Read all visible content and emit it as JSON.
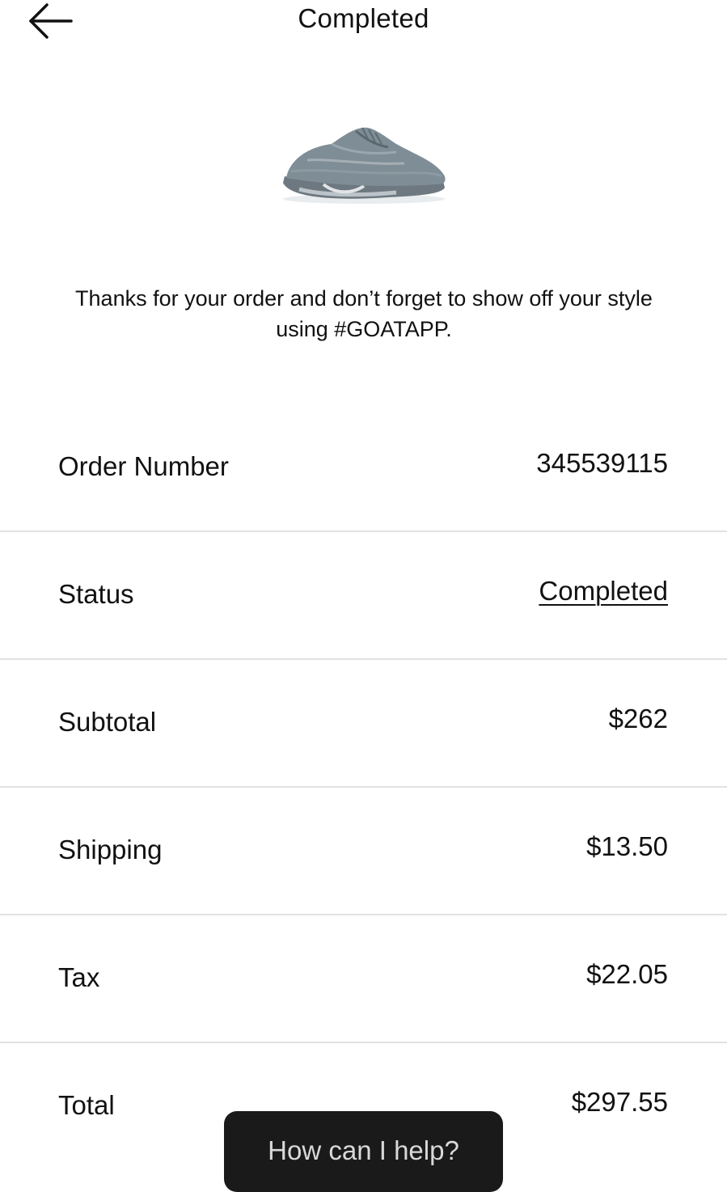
{
  "header": {
    "back_icon": "arrow-left-icon",
    "title": "Completed"
  },
  "product": {
    "image_icon": "sneaker-image"
  },
  "message": "Thanks for your order and don’t forget to show off your style using #GOATAPP.",
  "details": [
    {
      "label": "Order Number",
      "value": "345539115"
    },
    {
      "label": "Status",
      "value": "Completed"
    },
    {
      "label": "Subtotal",
      "value": "$262"
    },
    {
      "label": "Shipping",
      "value": "$13.50"
    },
    {
      "label": "Tax",
      "value": "$22.05"
    },
    {
      "label": "Total",
      "value": "$297.55"
    }
  ],
  "help_button": {
    "label": "How can I help?"
  }
}
